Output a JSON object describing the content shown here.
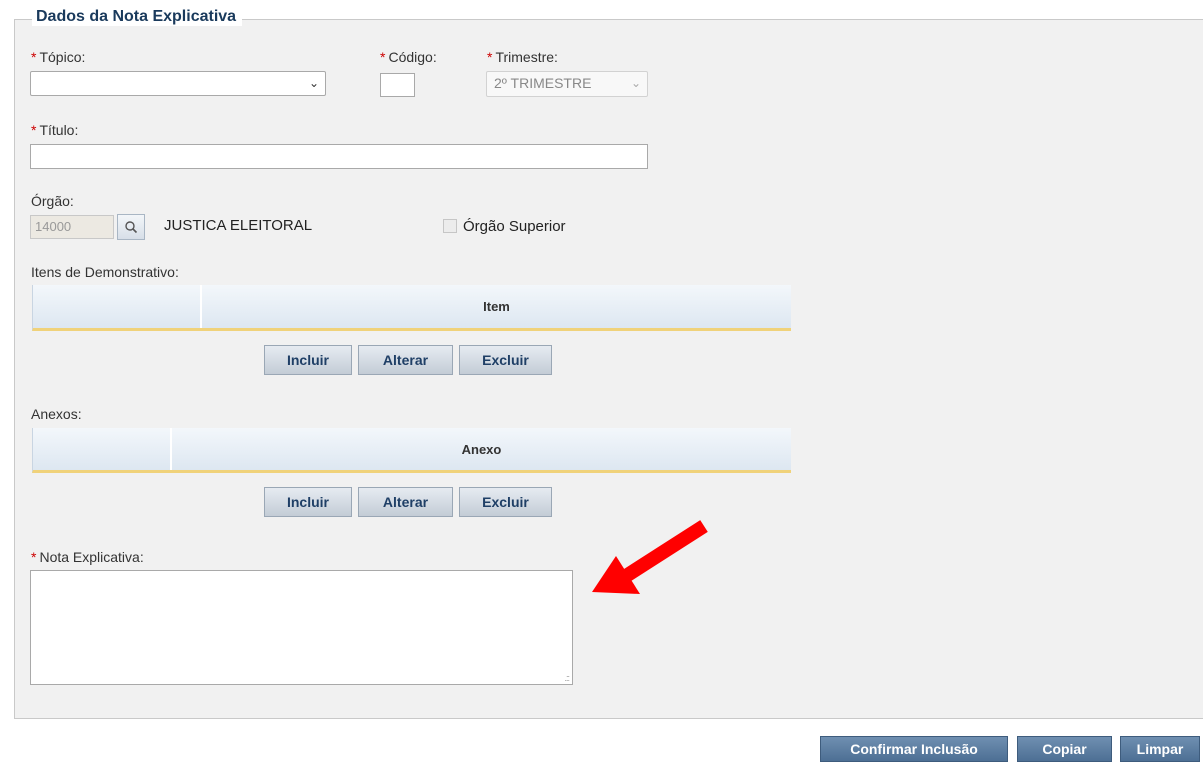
{
  "legend": "Dados da Nota Explicativa",
  "required_marker": "*",
  "fields": {
    "topico": {
      "label": "Tópico:",
      "value": ""
    },
    "codigo": {
      "label": "Código:",
      "value": ""
    },
    "trimestre": {
      "label": "Trimestre:",
      "value": "2º TRIMESTRE"
    },
    "titulo": {
      "label": "Título:",
      "value": ""
    },
    "orgao": {
      "label": "Órgão:",
      "code": "14000",
      "name": "JUSTICA ELEITORAL",
      "superior_label": "Órgão Superior"
    },
    "nota": {
      "label": "Nota Explicativa:",
      "value": ""
    }
  },
  "itens": {
    "label": "Itens de Demonstrativo:",
    "column": "Item"
  },
  "anexos": {
    "label": "Anexos:",
    "column": "Anexo"
  },
  "grid_buttons": {
    "incluir": "Incluir",
    "alterar": "Alterar",
    "excluir": "Excluir"
  },
  "footer": {
    "confirmar": "Confirmar Inclusão",
    "copiar": "Copiar",
    "limpar": "Limpar"
  },
  "icons": {
    "select_arrow": "chevron-down-icon",
    "lookup": "search-icon",
    "annotation": "red-arrow-icon"
  },
  "colors": {
    "required": "#cc0000",
    "grid_header_border": "#f0d27a",
    "footer_button": "#5a7ca0",
    "annotation_arrow": "#ff0000"
  }
}
